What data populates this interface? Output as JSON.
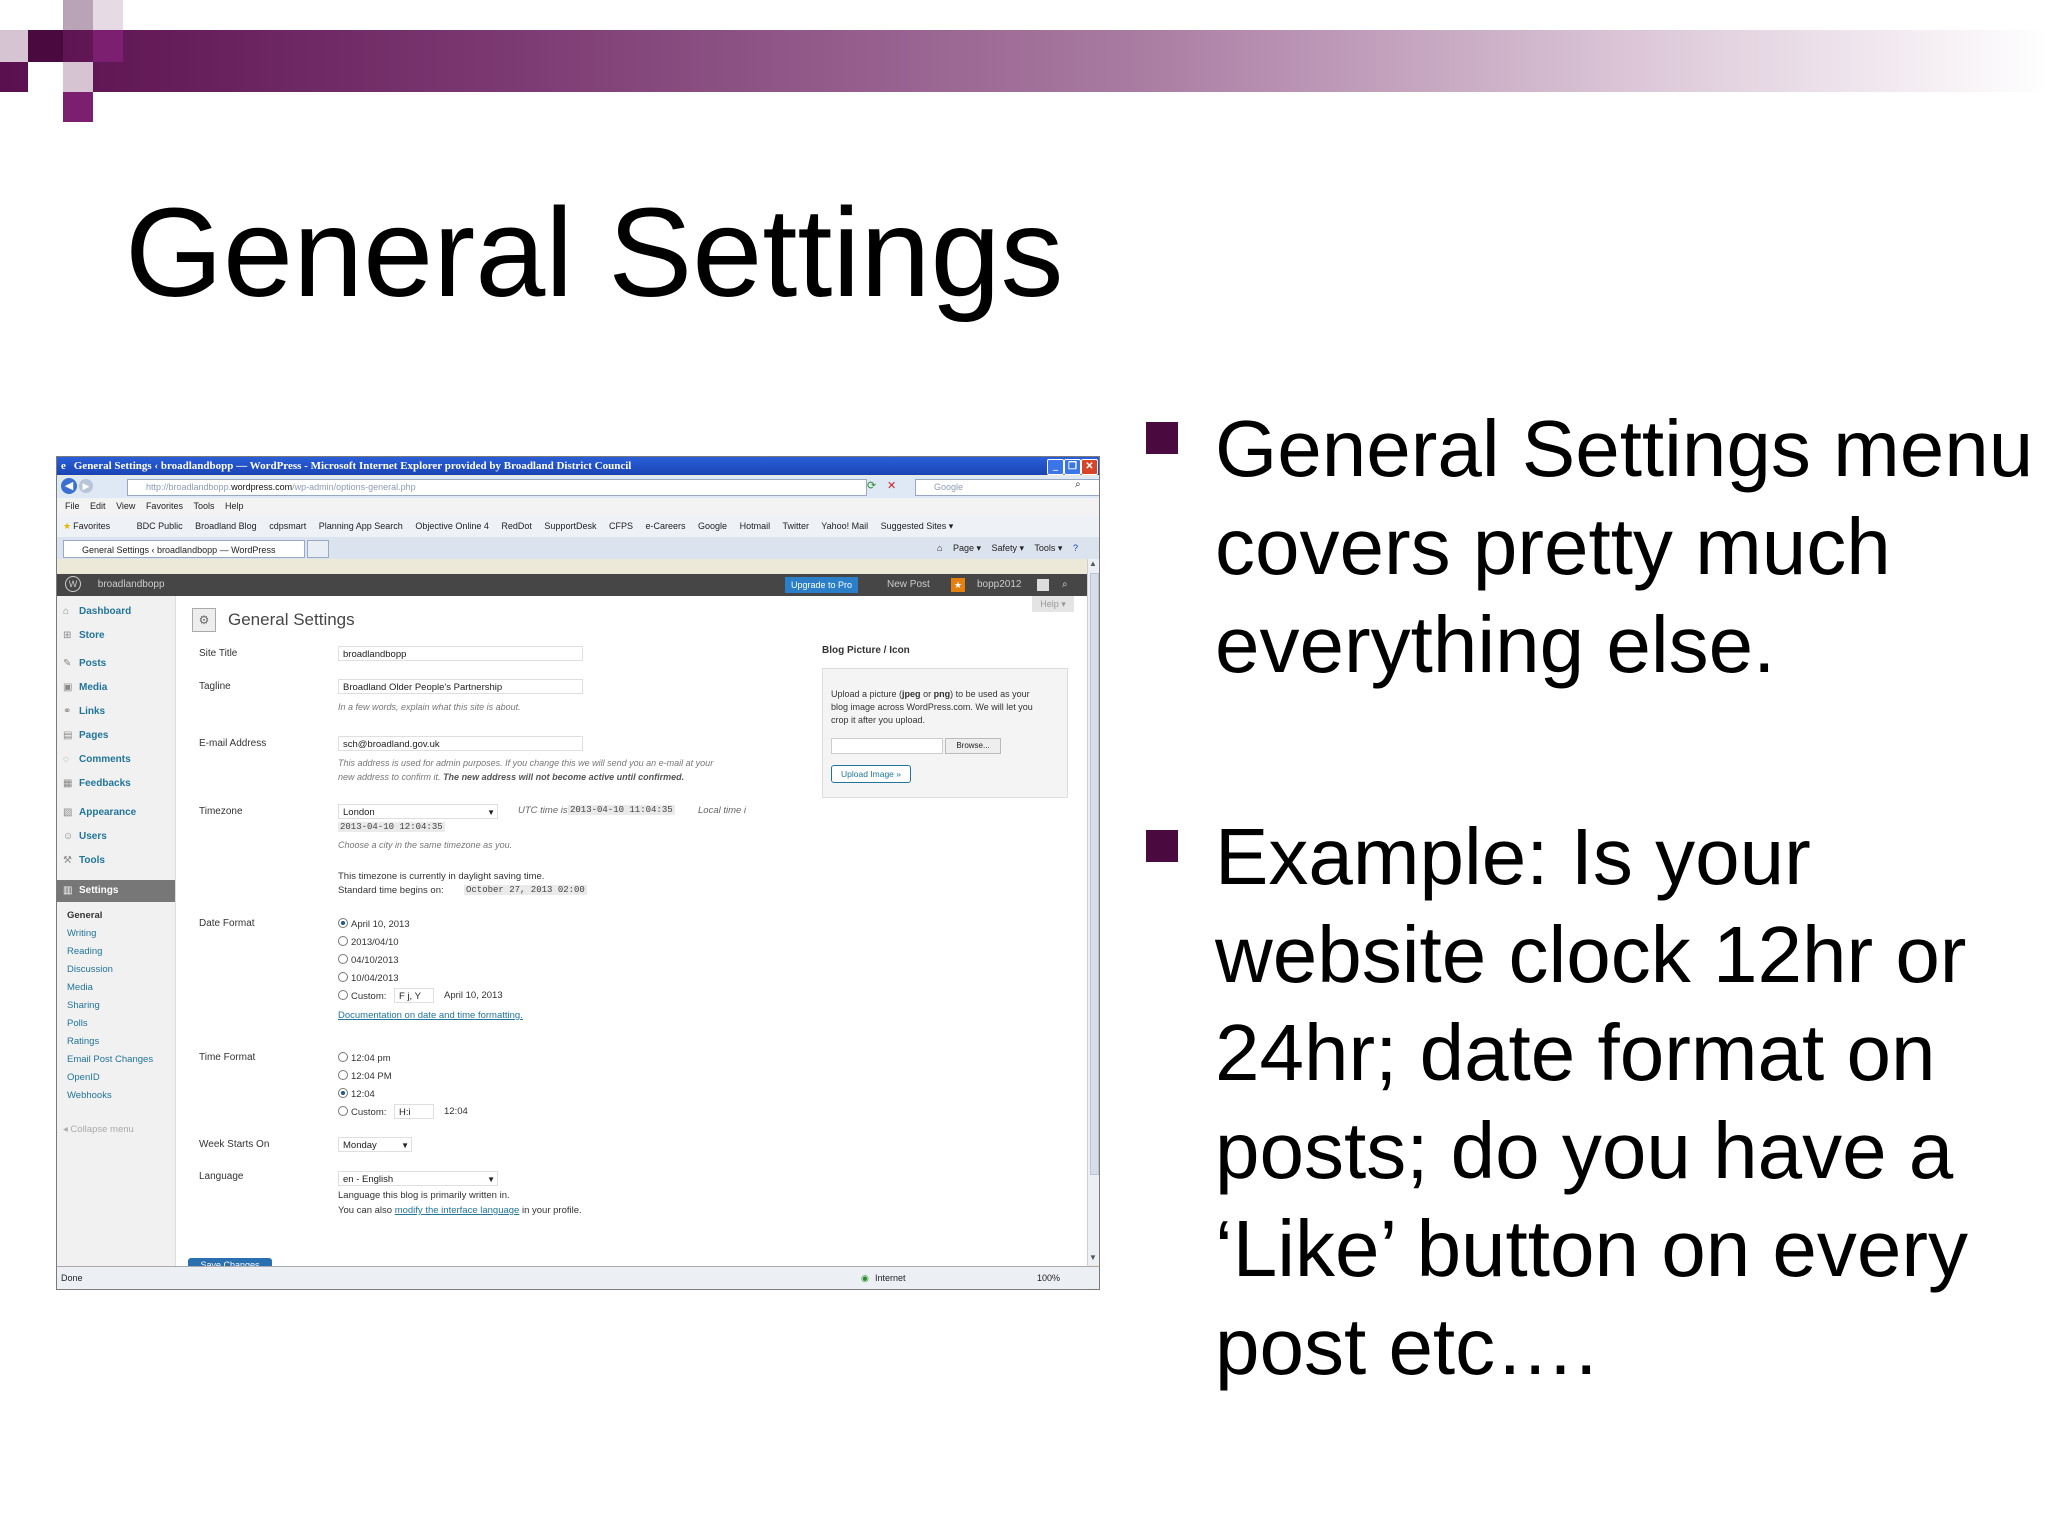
{
  "slide": {
    "title": "General Settings",
    "bullets": [
      "General Settings menu covers pretty much everything else.",
      "Example: Is your website clock 12hr or 24hr; date format on posts; do you have a ‘Like’ button on every post etc…."
    ]
  },
  "colors": {
    "accent": "#5a0f4e",
    "wp_link": "#21759b",
    "ie_title": "#1a44b4"
  },
  "browser": {
    "window_title": "General Settings ‹ broadlandbopp — WordPress - Microsoft Internet Explorer provided by Broadland District Council",
    "url_prefix": "http://broadlandbopp.",
    "url_domain": "wordpress.com",
    "url_path": "/wp-admin/options-general.php",
    "search_placeholder": "Google",
    "menu": [
      "File",
      "Edit",
      "View",
      "Favorites",
      "Tools",
      "Help"
    ],
    "favorites_label": "Favorites",
    "favorites": [
      "BDC Public",
      "Broadland Blog",
      "cdpsmart",
      "Planning App Search",
      "Objective Online 4",
      "RedDot",
      "SupportDesk",
      "CFPS",
      "e-Careers",
      "Google",
      "Hotmail",
      "Twitter",
      "Yahoo! Mail",
      "Suggested Sites ▾"
    ],
    "tab_title": "General Settings ‹ broadlandbopp — WordPress",
    "command_bar": [
      "Page ▾",
      "Safety ▾",
      "Tools ▾"
    ],
    "status_left": "Done",
    "status_zone": "Internet",
    "status_zoom": "100%"
  },
  "wp": {
    "site_name": "broadlandbopp",
    "upgrade_label": "Upgrade to Pro",
    "new_post": "New Post",
    "user": "bopp2012",
    "help": "Help ▾",
    "page_title": "General Settings",
    "menu": [
      "Dashboard",
      "Store",
      "Posts",
      "Media",
      "Links",
      "Pages",
      "Comments",
      "Feedbacks",
      "Appearance",
      "Users",
      "Tools",
      "Settings"
    ],
    "submenu": [
      "General",
      "Writing",
      "Reading",
      "Discussion",
      "Media",
      "Sharing",
      "Polls",
      "Ratings",
      "Email Post Changes",
      "OpenID",
      "Webhooks"
    ],
    "collapse": "Collapse menu",
    "fields": {
      "site_title_label": "Site Title",
      "site_title": "broadlandbopp",
      "tagline_label": "Tagline",
      "tagline": "Broadland Older People's Partnership",
      "tagline_hint": "In a few words, explain what this site is about.",
      "email_label": "E-mail Address",
      "email": "sch@broadland.gov.uk",
      "email_hint1": "This address is used for admin purposes. If you change this we will send you an e-mail at your",
      "email_hint2": "new address to confirm it.",
      "email_hint_bold": "The new address will not become active until confirmed.",
      "timezone_label": "Timezone",
      "timezone": "London",
      "utc_label": "UTC time is",
      "utc_time": "2013-04-10 11:04:35",
      "local_label": "Local time i",
      "local_time": "2013-04-10 12:04:35",
      "timezone_hint": "Choose a city in the same timezone as you.",
      "dst_note": "This timezone is currently in daylight saving time.",
      "std_label": "Standard time begins on:",
      "std_time": "October 27, 2013 02:00",
      "date_format_label": "Date Format",
      "date_options": [
        "April 10, 2013",
        "2013/04/10",
        "04/10/2013",
        "10/04/2013"
      ],
      "custom_label": "Custom:",
      "date_custom": "F j, Y",
      "date_custom_preview": "April 10, 2013",
      "doc_link": "Documentation on date and time formatting.",
      "time_format_label": "Time Format",
      "time_options": [
        "12:04 pm",
        "12:04 PM",
        "12:04"
      ],
      "time_custom": "H:i",
      "time_custom_preview": "12:04",
      "week_label": "Week Starts On",
      "week_value": "Monday",
      "language_label": "Language",
      "language_value": "en - English",
      "language_hint": "Language this blog is primarily written in.",
      "language_link_pre": "You can also",
      "language_link": "modify the interface language",
      "language_link_post": "in your profile.",
      "save_label": "Save Changes"
    },
    "blog_picture": {
      "title": "Blog Picture / Icon",
      "text1": "Upload a picture (",
      "jpeg": "jpeg",
      "or": " or ",
      "png": "png",
      "text2": ") to be used as your",
      "text3": "blog image across WordPress.com. We will let you",
      "text4": "crop it after you upload.",
      "browse": "Browse...",
      "upload": "Upload Image »"
    }
  }
}
